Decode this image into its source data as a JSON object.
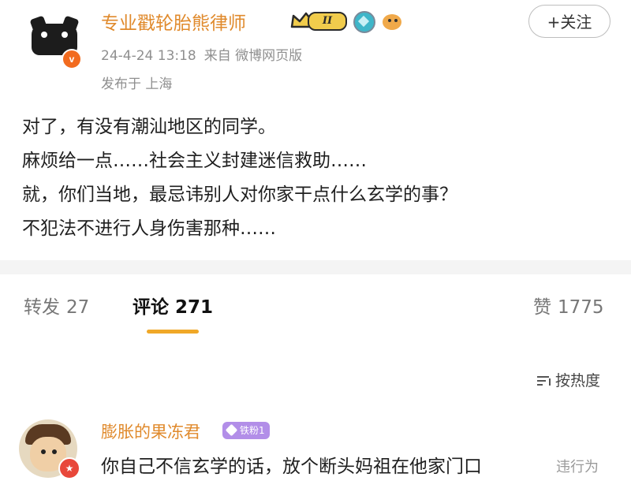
{
  "post": {
    "username": "专业戳轮胎熊律师",
    "level_badge": "II",
    "follow_label": "+关注",
    "timestamp": "24-4-24 13:18",
    "source": "来自 微博网页版",
    "location": "发布于 上海",
    "verified_mark": "v",
    "content_lines": [
      "对了，有没有潮汕地区的同学。",
      "麻烦给一点……社会主义封建迷信救助……",
      "就，你们当地，最忌讳别人对你家干点什么玄学的事？",
      "不犯法不进行人身伤害那种……"
    ]
  },
  "stats": {
    "repost_label": "转发",
    "repost_count": "27",
    "comments_label": "评论",
    "comments_count": "271",
    "likes_label": "赞",
    "likes_count": "1775"
  },
  "sort": {
    "label": "按热度"
  },
  "comment": {
    "username": "膨胀的果冻君",
    "fan_badge": "铁粉1",
    "text": "你自己不信玄学的话，放个断头妈祖在他家门口",
    "overlay_text": "违行为"
  },
  "colors": {
    "username": "#e08a2c",
    "active_tab_underline": "#f0a828",
    "verified_badge": "#f26b1f"
  }
}
